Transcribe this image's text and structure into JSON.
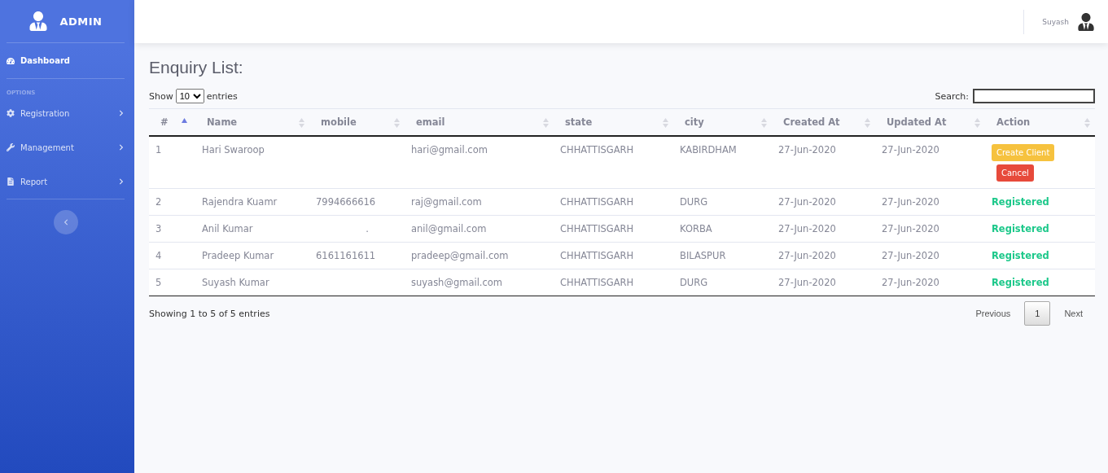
{
  "sidebar": {
    "brand": "ADMIN",
    "items": [
      {
        "label": "Dashboard",
        "selected": true
      }
    ],
    "section": "OPTIONS",
    "options": [
      {
        "label": "Registration",
        "has_children": true
      },
      {
        "label": "Management",
        "has_children": true
      },
      {
        "label": "Report",
        "has_children": true
      }
    ]
  },
  "topbar": {
    "user": "Suyash"
  },
  "page": {
    "title": "Enquiry List:",
    "length": {
      "before": "Show",
      "value": "10",
      "after": "entries"
    },
    "search": {
      "label": "Search:"
    },
    "table": {
      "columns": [
        {
          "label": "#",
          "sorted": true
        },
        {
          "label": "Name",
          "sorted": false
        },
        {
          "label": "mobile",
          "sorted": false
        },
        {
          "label": "email",
          "sorted": false
        },
        {
          "label": "state",
          "sorted": false
        },
        {
          "label": "city",
          "sorted": false
        },
        {
          "label": "Created At",
          "sorted": false
        },
        {
          "label": "Updated At",
          "sorted": false
        },
        {
          "label": "Action",
          "sorted": false
        }
      ],
      "rows": [
        {
          "cells": [
            "1",
            "Hari Swaroop",
            "",
            "hari@gmail.com",
            "CHHATTISGARH",
            "KABIRDHAM",
            "27-Jun-2020",
            "27-Jun-2020"
          ],
          "action": {
            "kind": "buttons",
            "buttons": [
              {
                "label": "Create Client",
                "kind": "warning"
              },
              {
                "label": "Cancel",
                "kind": "danger"
              }
            ]
          }
        },
        {
          "cells": [
            "2",
            "Rajendra Kuamr",
            "7994666616",
            "raj@gmail.com",
            "CHHATTISGARH",
            "DURG",
            "27-Jun-2020",
            "27-Jun-2020"
          ],
          "action": {
            "kind": "status",
            "label": "Registered"
          }
        },
        {
          "cells": [
            "3",
            "Anil Kumar",
            ".",
            "anil@gmail.com",
            "CHHATTISGARH",
            "KORBA",
            "27-Jun-2020",
            "27-Jun-2020"
          ],
          "action": {
            "kind": "status",
            "label": "Registered"
          }
        },
        {
          "cells": [
            "4",
            "Pradeep Kumar",
            "6161161611",
            "pradeep@gmail.com",
            "CHHATTISGARH",
            "BILASPUR",
            "27-Jun-2020",
            "27-Jun-2020"
          ],
          "action": {
            "kind": "status",
            "label": "Registered"
          }
        },
        {
          "cells": [
            "5",
            "Suyash Kumar",
            "",
            "suyash@gmail.com",
            "CHHATTISGARH",
            "DURG",
            "27-Jun-2020",
            "27-Jun-2020"
          ],
          "action": {
            "kind": "status",
            "label": "Registered"
          }
        }
      ]
    },
    "info": "Showing 1 to 5 of 5 entries",
    "pagination": [
      {
        "label": "Previous",
        "kind": "nav",
        "selected": false
      },
      {
        "label": "1",
        "kind": "page",
        "selected": true
      },
      {
        "label": "Next",
        "kind": "nav",
        "selected": false
      }
    ]
  }
}
